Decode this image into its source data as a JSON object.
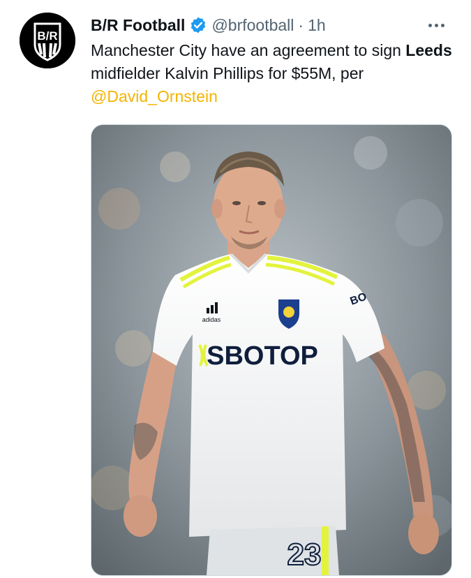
{
  "author": {
    "name": "B/R Football",
    "handle": "@brfootball",
    "separator": "·",
    "time": "1h",
    "avatar_text": "B/R",
    "verified": true,
    "avatar_color": "#000000"
  },
  "tweet": {
    "text_part1": "Manchester City have an agreement to sign ",
    "text_bold": "Leeds",
    "text_part2": " midfielder Kalvin Phillips for $55M, per ",
    "mention": "@David_Ornstein",
    "mention_color": "#f4b400"
  },
  "media": {
    "sponsor": "SBOTOP",
    "kit_brand": "adidas",
    "sleeve_text": "BO",
    "shorts_number": "23"
  },
  "icons": {
    "more": "more-dots-icon",
    "verified": "verified-badge-icon"
  },
  "colors": {
    "verified_blue": "#1d9bf0",
    "secondary_text": "#536471",
    "kit_yellow": "#e3f33d"
  }
}
